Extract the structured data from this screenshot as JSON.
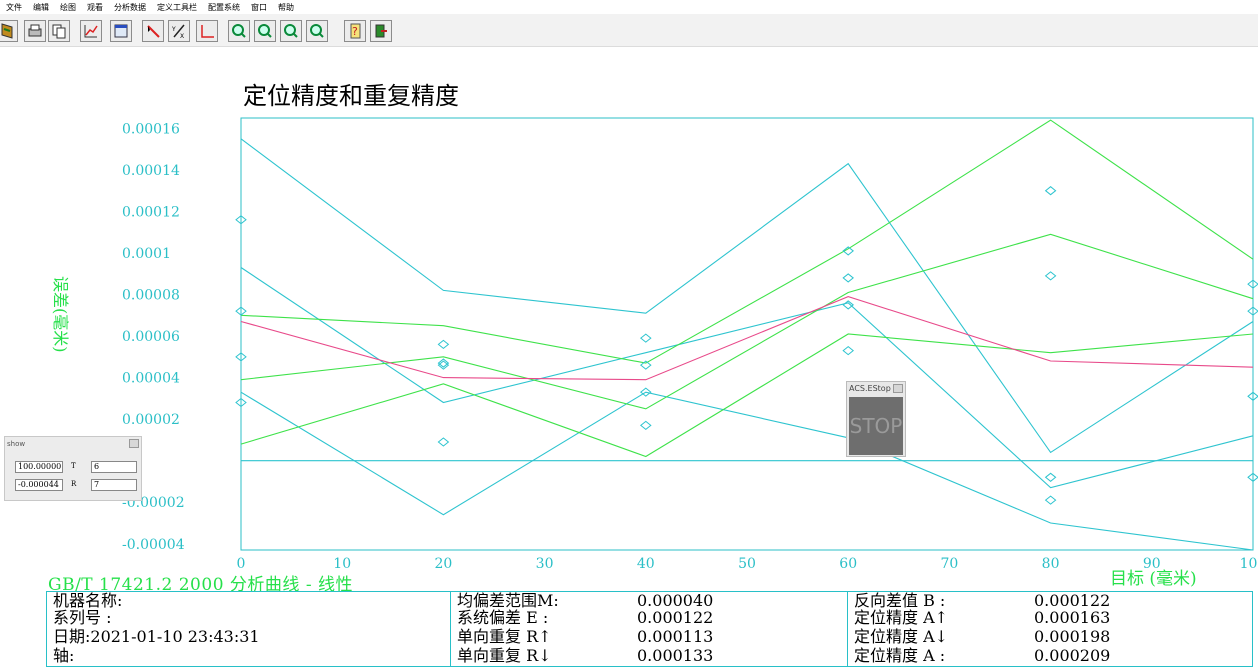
{
  "menu": [
    "文件",
    "编辑",
    "绘图",
    "观看",
    "分析数据",
    "定义工具栏",
    "配置系统",
    "窗口",
    "帮助"
  ],
  "toolbar_icons": [
    "open-icon",
    "print-icon",
    "copy-icon",
    "chart-icon",
    "window-icon",
    "pointer-icon",
    "measure-icon",
    "axis-icon",
    "zoom-in-icon",
    "zoom-out-icon",
    "zoom-x-icon",
    "zoom-y-icon",
    "help-icon",
    "exit-icon"
  ],
  "colors": {
    "cyan": "#2ec4cf",
    "green": "#3ee24a",
    "pink": "#e84a8a",
    "text_cyan": "#2bbfc7",
    "text_green": "#26e04a"
  },
  "chart_data": {
    "type": "line",
    "title": "定位精度和重复精度",
    "ylabel": "误差(毫米)",
    "xlabel": "目标 (毫米)",
    "x": [
      0,
      20,
      40,
      60,
      80,
      100
    ],
    "xticks": [
      "0",
      "10",
      "20",
      "30",
      "40",
      "50",
      "60",
      "70",
      "80",
      "90",
      "100"
    ],
    "xlim": [
      0,
      100
    ],
    "ylim": [
      -4.3e-05,
      0.000165
    ],
    "yticks": [
      -4e-05,
      -2e-05,
      0,
      2e-05,
      4e-05,
      6e-05,
      8e-05,
      0.0001,
      0.00012,
      0.00014,
      0.00016
    ],
    "ytick_labels": [
      "-0.00004",
      "-0.00002",
      "",
      "0.00002",
      "0.00004",
      "0.00006",
      "0.00008",
      "0.0001",
      "0.00012",
      "0.00014",
      "0.00016"
    ],
    "grid": false,
    "series": [
      {
        "color": "cyan",
        "values": [
          0.000155,
          8.2e-05,
          7.1e-05,
          0.000143,
          4e-06,
          6.7e-05
        ]
      },
      {
        "color": "cyan",
        "values": [
          9.3e-05,
          2.8e-05,
          5.2e-05,
          7.6e-05,
          -1.3e-05,
          1.2e-05
        ]
      },
      {
        "color": "cyan",
        "values": [
          3.3e-05,
          -2.6e-05,
          3.3e-05,
          1.1e-05,
          -3e-05,
          -4.3e-05
        ]
      },
      {
        "color": "green",
        "values": [
          7e-05,
          6.5e-05,
          4.7e-05,
          0.000102,
          0.000164,
          9.7e-05
        ]
      },
      {
        "color": "green",
        "values": [
          3.9e-05,
          5e-05,
          2.5e-05,
          8.1e-05,
          0.000109,
          7.8e-05
        ]
      },
      {
        "color": "green",
        "values": [
          8e-06,
          3.7e-05,
          2e-06,
          6.1e-05,
          5.2e-05,
          6.1e-05
        ]
      },
      {
        "color": "pink",
        "values": [
          6.7e-05,
          4e-05,
          3.9e-05,
          7.9e-05,
          4.8e-05,
          4.5e-05
        ]
      }
    ],
    "markers": [
      {
        "x": 0,
        "y": 0.000116
      },
      {
        "x": 0,
        "y": 7.2e-05
      },
      {
        "x": 0,
        "y": 5e-05
      },
      {
        "x": 0,
        "y": 2.8e-05
      },
      {
        "x": 20,
        "y": 5.6e-05
      },
      {
        "x": 20,
        "y": 4.7e-05
      },
      {
        "x": 20,
        "y": 4.6e-05
      },
      {
        "x": 20,
        "y": 9e-06
      },
      {
        "x": 40,
        "y": 5.9e-05
      },
      {
        "x": 40,
        "y": 4.6e-05
      },
      {
        "x": 40,
        "y": 3.3e-05
      },
      {
        "x": 40,
        "y": 1.7e-05
      },
      {
        "x": 60,
        "y": 0.000101
      },
      {
        "x": 60,
        "y": 8.8e-05
      },
      {
        "x": 60,
        "y": 7.5e-05
      },
      {
        "x": 60,
        "y": 5.3e-05
      },
      {
        "x": 80,
        "y": 0.00013
      },
      {
        "x": 80,
        "y": 8.9e-05
      },
      {
        "x": 80,
        "y": -8e-06
      },
      {
        "x": 80,
        "y": -1.9e-05
      },
      {
        "x": 100,
        "y": 8.5e-05
      },
      {
        "x": 100,
        "y": 7.2e-05
      },
      {
        "x": 100,
        "y": 3.1e-05
      },
      {
        "x": 100,
        "y": -8e-06
      }
    ]
  },
  "footer": {
    "title": "GB/T 17421.2 2000 分析曲线 - 线性",
    "x_unit": "目标 (毫米)"
  },
  "info": {
    "col1": [
      "机器名称:",
      "系列号   :",
      "日期:2021-01-10 23:43:31",
      "轴:"
    ],
    "col2": [
      {
        "label": "均偏差范围M:",
        "value": "0.000040"
      },
      {
        "label": "系统偏差 E :",
        "value": "0.000122"
      },
      {
        "label": "单向重复 R↑",
        "value": "0.000113"
      },
      {
        "label": "单向重复 R↓",
        "value": "0.000133"
      }
    ],
    "col3": [
      {
        "label": "反向差值 B :",
        "value": "0.000122"
      },
      {
        "label": "定位精度 A↑",
        "value": "0.000163"
      },
      {
        "label": "定位精度 A↓",
        "value": "0.000198"
      },
      {
        "label": "定位精度 A :",
        "value": "0.000209"
      }
    ]
  },
  "show_window": {
    "title": "show",
    "field1": "100.00000",
    "label1": "T",
    "field2": "6",
    "field3": "-0.000044",
    "label2": "R",
    "field4": "7"
  },
  "estop": {
    "title": "ACS.EStop",
    "label": "STOP"
  }
}
